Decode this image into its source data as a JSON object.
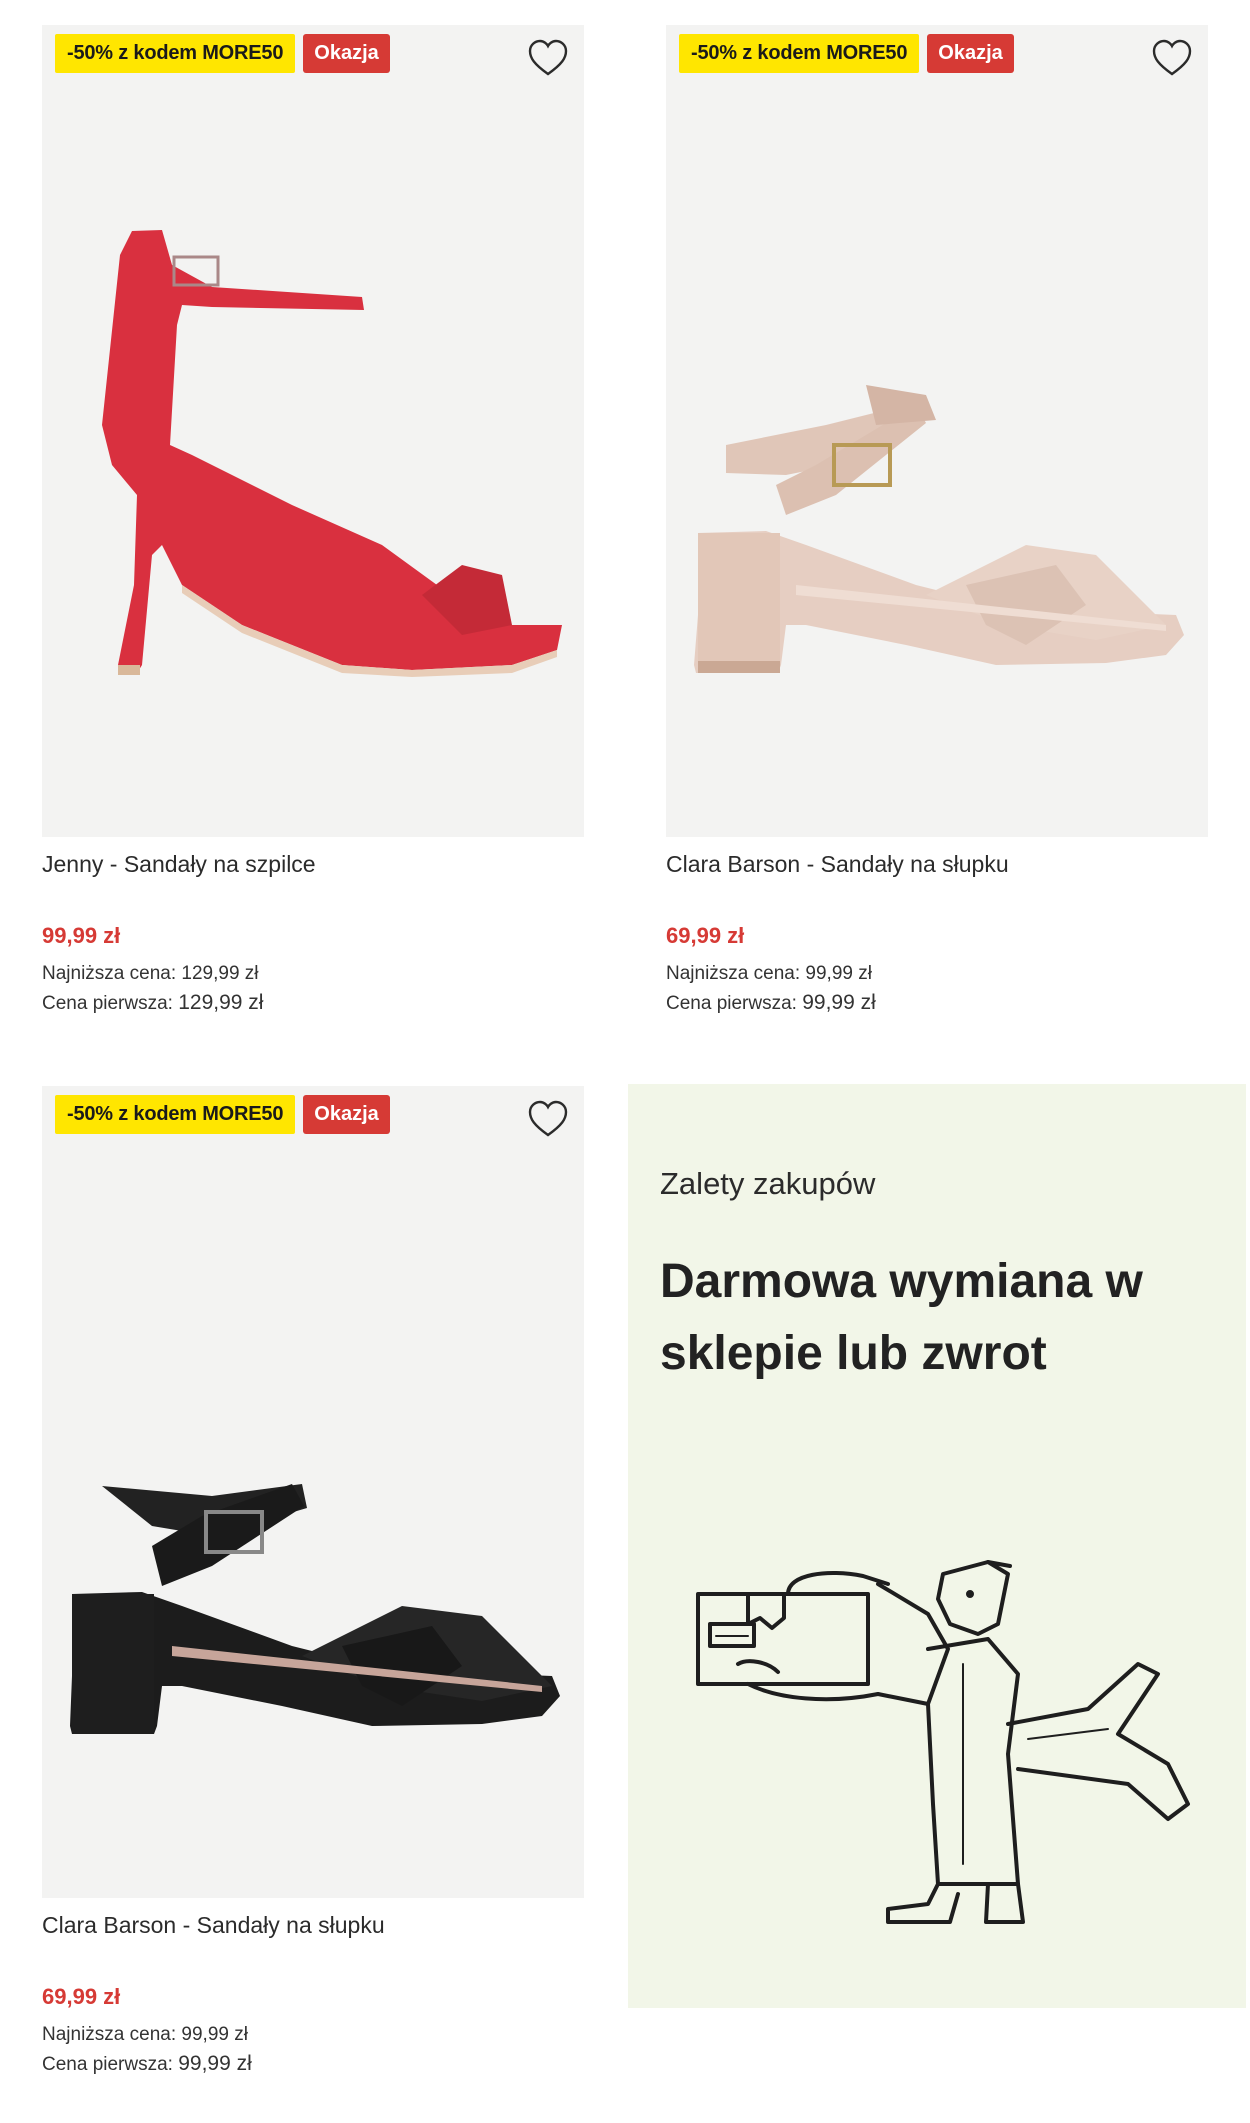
{
  "products": [
    {
      "promo_badge": "-50% z kodem MORE50",
      "sale_badge": "Okazja",
      "title": "Jenny - Sandały na szpilce",
      "price": "99,99 zł",
      "lowest_label": "Najniższa cena:",
      "lowest_value": "129,99 zł",
      "original_label": "Cena pierwsza:",
      "original_value": "129,99 zł",
      "image_icon": "red-stiletto-sandal"
    },
    {
      "promo_badge": "-50% z kodem MORE50",
      "sale_badge": "Okazja",
      "title": "Clara Barson - Sandały na słupku",
      "price": "69,99 zł",
      "lowest_label": "Najniższa cena:",
      "lowest_value": "99,99 zł",
      "original_label": "Cena pierwsza:",
      "original_value": "99,99 zł",
      "image_icon": "beige-block-heel-sandal"
    },
    {
      "promo_badge": "-50% z kodem MORE50",
      "sale_badge": "Okazja",
      "title": "Clara Barson - Sandały na słupku",
      "price": "69,99 zł",
      "lowest_label": "Najniższa cena:",
      "lowest_value": "99,99 zł",
      "original_label": "Cena pierwsza:",
      "original_value": "99,99 zł",
      "image_icon": "black-block-heel-sandal"
    }
  ],
  "promo": {
    "kicker": "Zalety zakupów",
    "headline": "Darmowa wymiana w sklepie lub zwrot",
    "illustration_icon": "courier-carrying-parcel"
  },
  "colors": {
    "price": "#d63a35",
    "sale_badge": "#d63a35",
    "promo_badge": "#ffe600",
    "image_bg": "#f3f3f2",
    "promo_bg": "#f2f6e8"
  }
}
